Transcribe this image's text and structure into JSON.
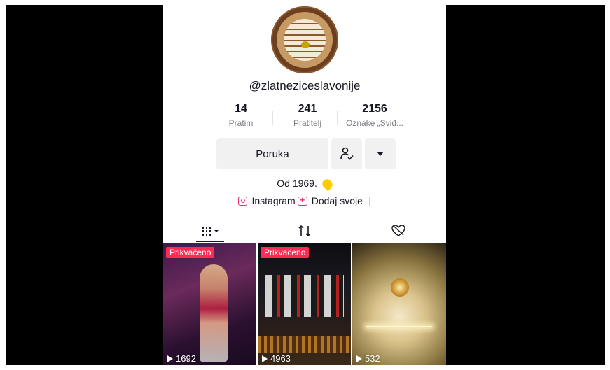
{
  "profile": {
    "username": "@zlatneziceslavonije",
    "bio": "Od 1969.",
    "instagram_label": "Instagram",
    "add_label": "Dodaj svoje",
    "separator": "|"
  },
  "stats": [
    {
      "value": "14",
      "label": "Pratim"
    },
    {
      "value": "241",
      "label": "Pratitelj"
    },
    {
      "value": "2156",
      "label": "Oznake „Sviđ..."
    }
  ],
  "buttons": {
    "message_label": "Poruka",
    "follow_icon": "person-check-icon",
    "more_icon": "caret-down-icon"
  },
  "tabs": [
    {
      "name": "videos",
      "icon": "grid-icon",
      "active": true
    },
    {
      "name": "reposts",
      "icon": "repost-icon",
      "active": false
    },
    {
      "name": "liked",
      "icon": "heart-lock-icon",
      "active": false
    }
  ],
  "videos": [
    {
      "pinned_label": "Prikvačeno",
      "views": "1692"
    },
    {
      "pinned_label": "Prikvačeno",
      "views": "4963"
    },
    {
      "pinned_label": "",
      "views": "532"
    }
  ],
  "colors": {
    "accent_pink": "#fe2c55",
    "instagram": "#e1306c",
    "text_primary": "#161823",
    "text_secondary": "#7c7d85",
    "button_bg": "#f1f1f2"
  }
}
